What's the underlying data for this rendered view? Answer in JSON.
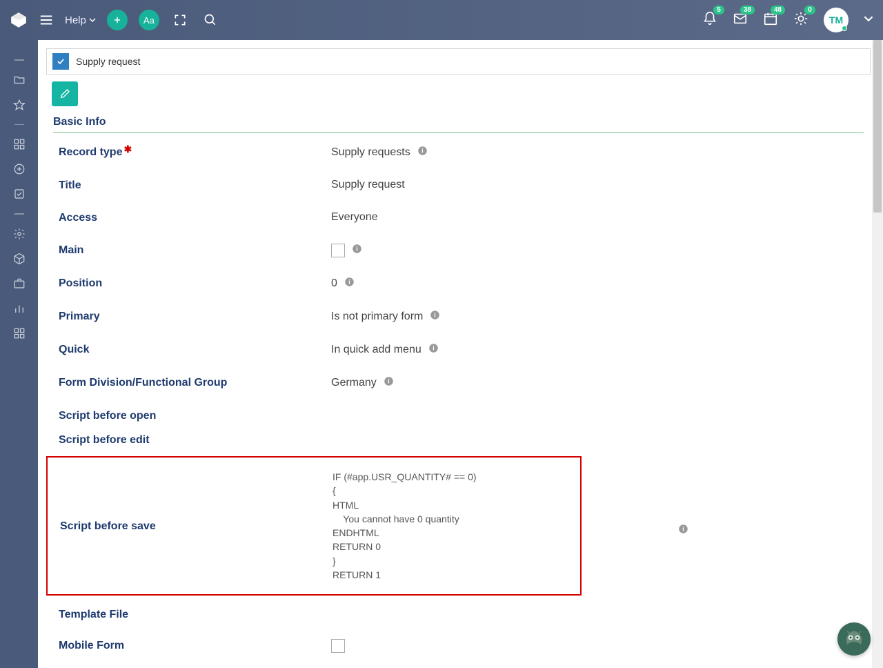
{
  "topbar": {
    "help_label": "Help",
    "aa_label": "Aa",
    "notifications": {
      "bell": "5",
      "mail": "38",
      "calendar": "48",
      "weather": "0"
    },
    "avatar_initials": "TM"
  },
  "card": {
    "title": "Supply request",
    "section": "Basic Info"
  },
  "fields": {
    "record_type": {
      "label": "Record type",
      "value": "Supply requests"
    },
    "title": {
      "label": "Title",
      "value": "Supply request"
    },
    "access": {
      "label": "Access",
      "value": "Everyone"
    },
    "main": {
      "label": "Main"
    },
    "position": {
      "label": "Position",
      "value": "0"
    },
    "primary": {
      "label": "Primary",
      "value": "Is not primary form"
    },
    "quick": {
      "label": "Quick",
      "value": "In quick add menu"
    },
    "division": {
      "label": "Form Division/Functional Group",
      "value": "Germany"
    },
    "script_open": {
      "label": "Script before open"
    },
    "script_edit": {
      "label": "Script before edit"
    },
    "script_save": {
      "label": "Script before save",
      "code": "IF (#app.USR_QUANTITY# == 0)\n{\nHTML\n    You cannot have 0 quantity\nENDHTML\nRETURN 0\n}\nRETURN 1"
    },
    "template_file": {
      "label": "Template File"
    },
    "mobile_form": {
      "label": "Mobile Form"
    }
  }
}
